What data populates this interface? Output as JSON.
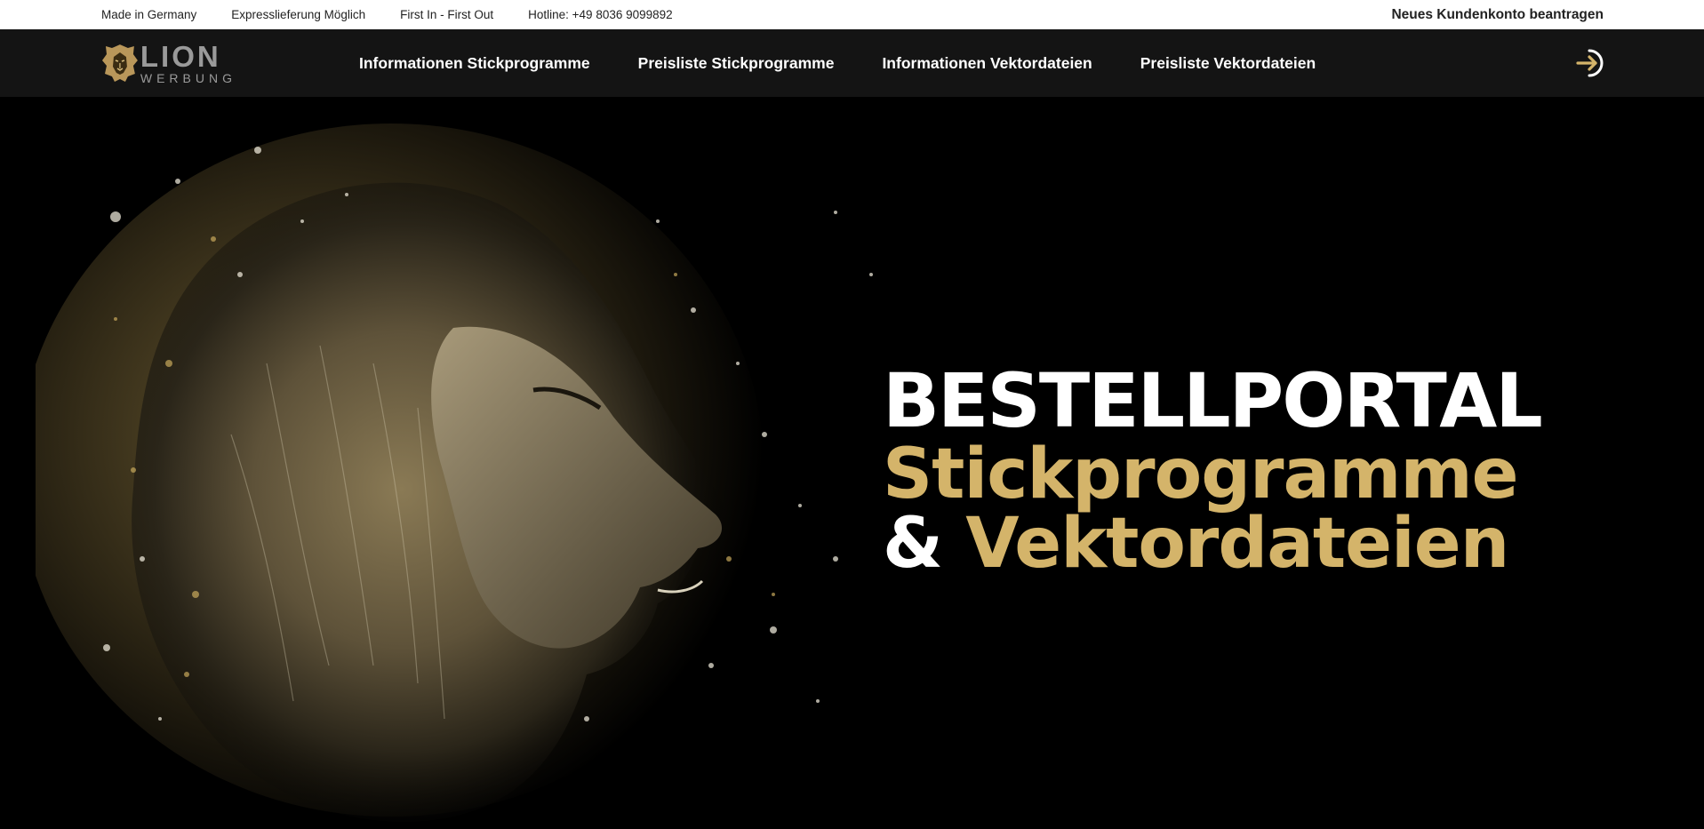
{
  "topbar": {
    "items": [
      "Made in Germany",
      "Expresslieferung Möglich",
      "First In - First Out",
      "Hotline: +49 8036 9099892"
    ],
    "account_link": "Neues Kundenkonto beantragen"
  },
  "logo": {
    "line1": "LION",
    "line2": "WERBUNG",
    "icon": "lion-head-icon"
  },
  "nav": {
    "items": [
      "Informationen Stickprogramme",
      "Preisliste Stickprogramme",
      "Informationen Vektordateien",
      "Preisliste Vektordateien"
    ],
    "login_icon": "login-arrow-icon"
  },
  "hero": {
    "line1": "BESTELLPORTAL",
    "line2": "Stickprogramme",
    "line3_amp": "&",
    "line3_rest": "Vektordateien",
    "image": "lion-splash-illustration"
  },
  "colors": {
    "accent": "#d4b46a",
    "navbar": "#141414",
    "background": "#000000",
    "topbar": "#ffffff"
  }
}
